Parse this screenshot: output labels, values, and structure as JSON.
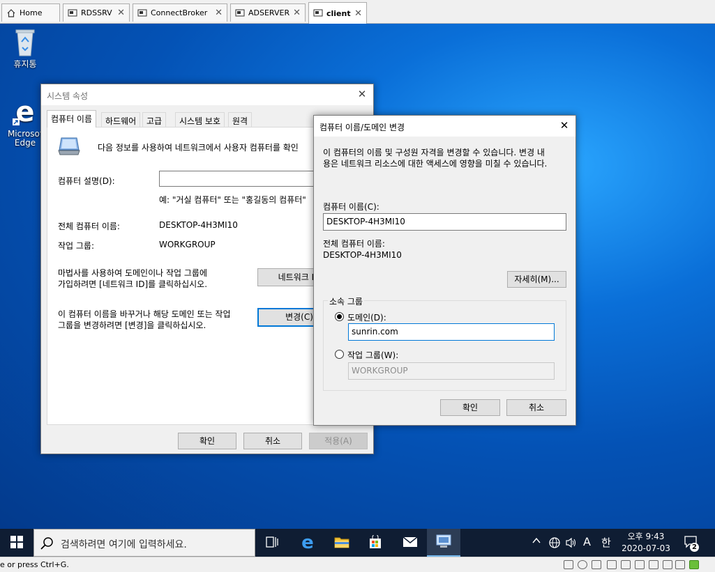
{
  "tabs": [
    {
      "label": "Home",
      "icon": "home-icon"
    },
    {
      "label": "RDSSRV",
      "icon": "vm-icon"
    },
    {
      "label": "ConnectBroker",
      "icon": "vm-icon"
    },
    {
      "label": "ADSERVER",
      "icon": "vm-icon"
    },
    {
      "label": "client",
      "icon": "vm-icon",
      "active": true
    }
  ],
  "desktop": {
    "recycle_bin_label": "휴지통",
    "edge_label_1": "Microsof",
    "edge_label_2": "Edge"
  },
  "system_props": {
    "title": "시스템 속성",
    "tabs": [
      "컴퓨터 이름",
      "하드웨어",
      "고급",
      "시스템 보호",
      "원격"
    ],
    "info_text": "다음 정보를 사용하여 네트워크에서 사용자 컴퓨터를 확인",
    "description_label": "컴퓨터 설명(D):",
    "description_value": "",
    "example_text": "예: \"거실 컴퓨터\" 또는 \"홍길동의 컴퓨터\"",
    "full_name_label": "전체 컴퓨터 이름:",
    "full_name_value": "DESKTOP-4H3MI10",
    "workgroup_label": "작업 그룹:",
    "workgroup_value": "WORKGROUP",
    "wizard_text_1": "마법사를 사용하여 도메인이나 작업 그룹에",
    "wizard_text_2": "가입하려면 [네트워크 ID]를 클릭하십시오.",
    "network_id_button": "네트워크 ID",
    "change_text_1": "이 컴퓨터 이름을 바꾸거나 해당 도메인 또는 작업",
    "change_text_2": "그룹을 변경하려면 [변경]을 클릭하십시오.",
    "change_button": "변경(C)",
    "ok_button": "확인",
    "cancel_button": "취소",
    "apply_button": "적용(A)"
  },
  "change_dialog": {
    "title": "컴퓨터 이름/도메인 변경",
    "info_1": "이 컴퓨터의 이름 및 구성원 자격을 변경할 수 있습니다. 변경 내",
    "info_2": "용은 네트워크 리소스에 대한 액세스에 영향을 미칠 수 있습니다.",
    "computer_name_label": "컴퓨터 이름(C):",
    "computer_name_value": "DESKTOP-4H3MI10",
    "full_name_label": "전체 컴퓨터 이름:",
    "full_name_value": "DESKTOP-4H3MI10",
    "more_button": "자세히(M)...",
    "member_of_label": "소속 그룹",
    "domain_label": "도메인(D):",
    "domain_value": "sunrin.com",
    "workgroup_label": "작업 그룹(W):",
    "workgroup_value": "WORKGROUP",
    "ok_button": "확인",
    "cancel_button": "취소"
  },
  "taskbar": {
    "search_placeholder": "검색하려면 여기에 입력하세요.",
    "ime_label": "A",
    "ime_han": "한",
    "time": "오후 9:43",
    "date": "2020-07-03",
    "notification_count": "2"
  },
  "statusbar": {
    "text": "e or press Ctrl+G."
  },
  "colors": {
    "accent": "#0078d7",
    "taskbar": "#0f1d33",
    "desktop": "#0a6fd8"
  }
}
